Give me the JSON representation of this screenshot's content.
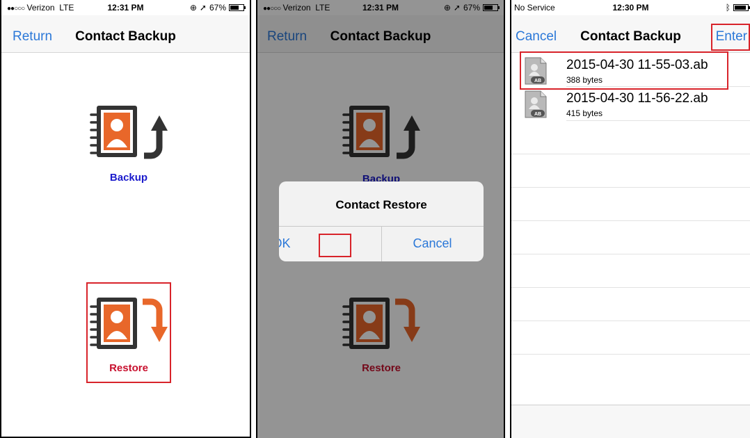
{
  "panel1": {
    "status": {
      "carrier": "Verizon",
      "network": "LTE",
      "time": "12:31 PM",
      "battery": "67%",
      "battery_level": 0.67
    },
    "nav": {
      "back_label": "Return",
      "title": "Contact Backup"
    },
    "backup_label": "Backup",
    "restore_label": "Restore"
  },
  "panel2": {
    "status": {
      "carrier": "Verizon",
      "network": "LTE",
      "time": "12:31 PM",
      "battery": "67%",
      "battery_level": 0.67
    },
    "nav": {
      "back_label": "Return",
      "title": "Contact Backup"
    },
    "backup_label": "Backup",
    "restore_label": "Restore",
    "alert": {
      "title": "Contact Restore",
      "ok_label": "OK",
      "cancel_label": "Cancel"
    }
  },
  "panel3": {
    "status": {
      "carrier": "No Service",
      "time": "12:30 PM",
      "battery_level": 0.9
    },
    "nav": {
      "cancel_label": "Cancel",
      "title": "Contact Backup",
      "enter_label": "Enter"
    },
    "files": [
      {
        "name": "2015-04-30 11-55-03.ab",
        "size": "388 bytes",
        "badge": "AB"
      },
      {
        "name": "2015-04-30 11-56-22.ab",
        "size": "415 bytes",
        "badge": "AB"
      }
    ]
  },
  "colors": {
    "accent_blue": "#2b78d8",
    "backup_label_blue": "#1a1acc",
    "restore_label_red": "#c8102e",
    "orange": "#e8672a",
    "highlight_red": "#d8232a",
    "dark_icon": "#333333"
  },
  "icons": {
    "backup": "contact-book-up-arrow-icon",
    "restore": "contact-book-down-arrow-icon",
    "file": "ab-file-icon"
  }
}
